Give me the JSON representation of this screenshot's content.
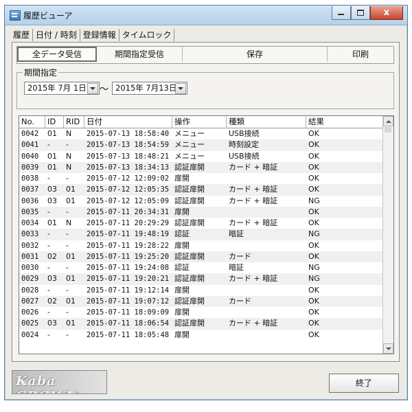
{
  "window": {
    "title": "履歴ビューア"
  },
  "tabs": [
    "履歴",
    "日付 / 時刻",
    "登録情報",
    "タイムロック"
  ],
  "toolbar": {
    "all_receive": "全データ受信",
    "period_receive": "期間指定受信",
    "save": "保存",
    "print": "印刷"
  },
  "period": {
    "group_label": "期間指定",
    "from": "2015年 7月 1日",
    "to": "2015年 7月13日",
    "separator": "〜"
  },
  "table": {
    "columns": [
      "No.",
      "ID",
      "RID",
      "日付",
      "操作",
      "種類",
      "結果"
    ],
    "rows": [
      [
        "0042",
        "01",
        "N",
        "2015-07-13 18:58:40",
        "メニュー",
        "USB接続",
        "OK"
      ],
      [
        "0041",
        "-",
        "-",
        "2015-07-13 18:54:59",
        "メニュー",
        "時刻設定",
        "OK"
      ],
      [
        "0040",
        "01",
        "N",
        "2015-07-13 18:48:21",
        "メニュー",
        "USB接続",
        "OK"
      ],
      [
        "0039",
        "01",
        "N",
        "2015-07-13 18:34:13",
        "認証扉開",
        "カード + 暗証",
        "OK"
      ],
      [
        "0038",
        "-",
        "-",
        "2015-07-12 12:09:02",
        "扉開",
        "",
        "OK"
      ],
      [
        "0037",
        "03",
        "01",
        "2015-07-12 12:05:35",
        "認証扉開",
        "カード + 暗証",
        "OK"
      ],
      [
        "0036",
        "03",
        "01",
        "2015-07-12 12:05:09",
        "認証扉開",
        "カード + 暗証",
        "NG"
      ],
      [
        "0035",
        "-",
        "-",
        "2015-07-11 20:34:31",
        "扉開",
        "",
        "OK"
      ],
      [
        "0034",
        "01",
        "N",
        "2015-07-11 20:29:29",
        "認証扉開",
        "カード + 暗証",
        "OK"
      ],
      [
        "0033",
        "-",
        "-",
        "2015-07-11 19:48:19",
        "認証",
        "暗証",
        "NG"
      ],
      [
        "0032",
        "-",
        "-",
        "2015-07-11 19:28:22",
        "扉開",
        "",
        "OK"
      ],
      [
        "0031",
        "02",
        "01",
        "2015-07-11 19:25:20",
        "認証扉開",
        "カード",
        "OK"
      ],
      [
        "0030",
        "-",
        "-",
        "2015-07-11 19:24:08",
        "認証",
        "暗証",
        "NG"
      ],
      [
        "0029",
        "03",
        "01",
        "2015-07-11 19:20:21",
        "認証扉開",
        "カード + 暗証",
        "NG"
      ],
      [
        "0028",
        "-",
        "-",
        "2015-07-11 19:12:14",
        "扉開",
        "",
        "OK"
      ],
      [
        "0027",
        "02",
        "01",
        "2015-07-11 19:07:12",
        "認証扉開",
        "カード",
        "OK"
      ],
      [
        "0026",
        "-",
        "-",
        "2015-07-11 18:09:09",
        "扉開",
        "",
        "OK"
      ],
      [
        "0025",
        "03",
        "01",
        "2015-07-11 18:06:54",
        "認証扉開",
        "カード + 暗証",
        "OK"
      ],
      [
        "0024",
        "-",
        "-",
        "2015-07-11 18:05:48",
        "扉開",
        "",
        "OK"
      ]
    ]
  },
  "footer": {
    "logo": "Kaba CROWN",
    "exit": "終了"
  },
  "icons": {
    "app": "app-window-icon",
    "minimize": "minimize-icon",
    "maximize": "maximize-icon",
    "close": "close-icon",
    "dropdown": "chevron-down-icon"
  }
}
